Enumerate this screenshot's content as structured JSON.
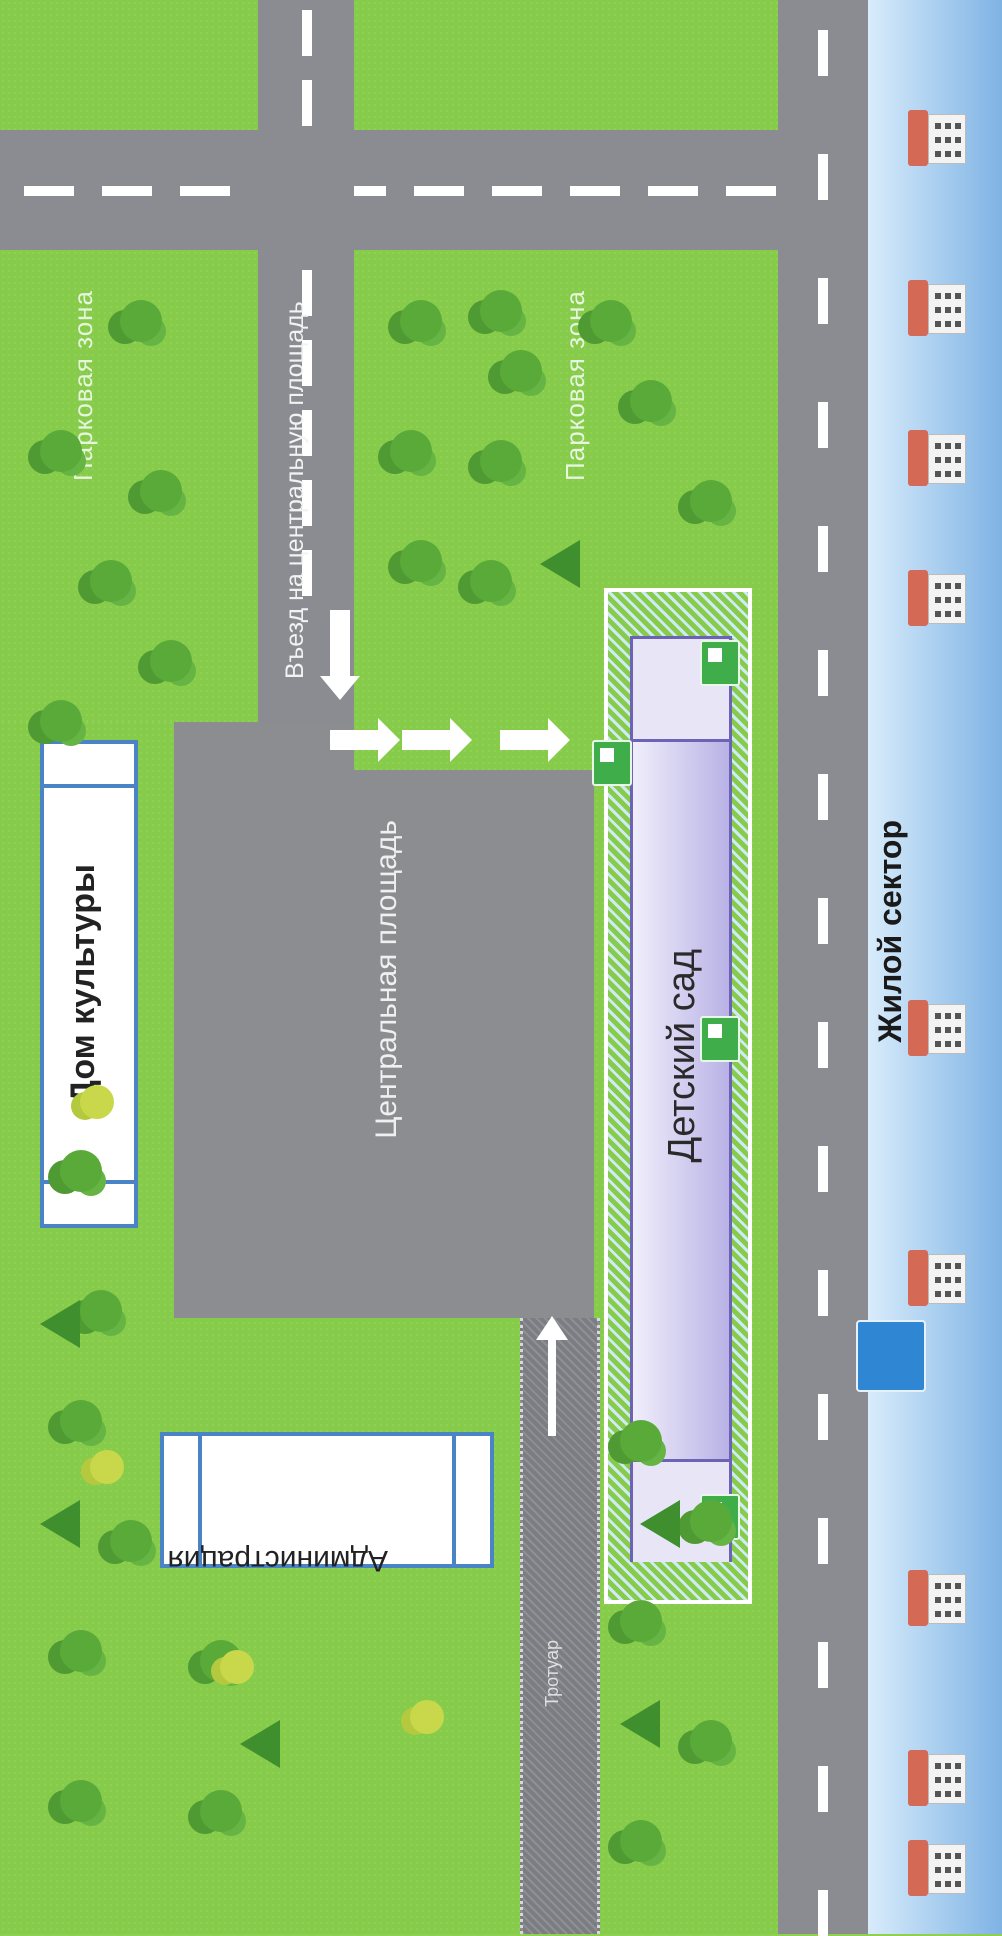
{
  "labels": {
    "park_zone_top": "Парковая зона",
    "park_zone_bottom": "Парковая зона",
    "entrance": "Въезд на центральную площадь",
    "central_square": "Центральная площадь",
    "culture_house": "Дом культуры",
    "administration": "Администрация",
    "kindergarten": "Детский сад",
    "residential": "Жилой сектор",
    "sidewalk": "Тротуар"
  },
  "colors": {
    "grass": "#86cc4a",
    "road": "#8a8c91",
    "building_border": "#4a83c6",
    "kindergarten_fill": "#dcd7f2",
    "residential_sky": "#9fc8ee",
    "sign_green": "#3fae4a",
    "sign_blue": "#2f86d2",
    "house_roof": "#d46a55"
  },
  "icons": {
    "tree": "tree-icon",
    "house": "house-icon",
    "kids_sign": "children-crossing-sign-icon",
    "pedestrian_sign": "pedestrian-crossing-sign-icon",
    "arrow": "arrow-icon"
  }
}
